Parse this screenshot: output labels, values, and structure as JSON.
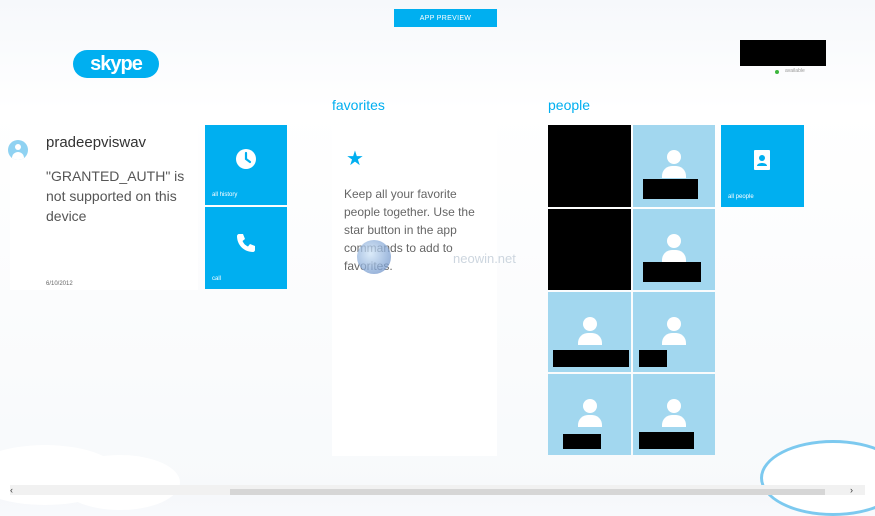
{
  "header": {
    "badge": "APP PREVIEW",
    "logo": "skype",
    "user_status": "available"
  },
  "sections": {
    "favorites": "favorites",
    "people": "people"
  },
  "recent": {
    "name": "pradeepviswav",
    "message": "\"GRANTED_AUTH\" is not supported on this device",
    "date": "6/10/2012"
  },
  "tiles": {
    "history_label": "all history",
    "call_label": "call",
    "all_people_label": "all people"
  },
  "favorites": {
    "text": "Keep all your favorite people together. Use the star button in the app commands to add to favorites."
  },
  "watermark": "neowin.net",
  "icons": {
    "history": "clock-icon",
    "call": "phone-icon",
    "people": "contacts-book-icon",
    "favorites": "star-icon"
  },
  "colors": {
    "accent": "#00aff0",
    "tile_light": "#a2d7ef"
  }
}
